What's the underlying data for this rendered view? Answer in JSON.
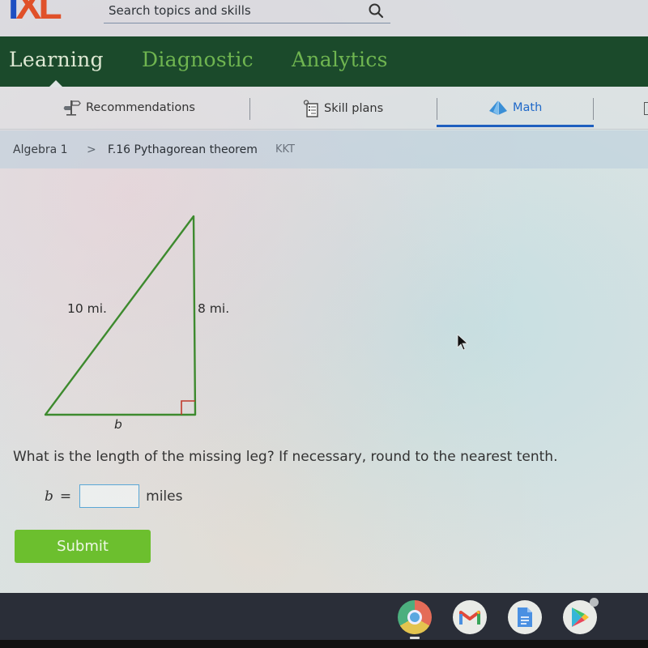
{
  "header": {
    "logo": {
      "i": "I",
      "x": "X",
      "l": "L"
    },
    "search_placeholder": "Search topics and skills",
    "search_icon": "search-icon"
  },
  "nav": {
    "items": [
      {
        "label": "Learning",
        "active": true
      },
      {
        "label": "Diagnostic",
        "active": false
      },
      {
        "label": "Analytics",
        "active": false
      }
    ]
  },
  "subnav": {
    "items": [
      {
        "label": "Recommendations",
        "icon": "signpost-icon",
        "active": false
      },
      {
        "label": "Skill plans",
        "icon": "clipboard-icon",
        "active": false
      },
      {
        "label": "Math",
        "icon": "pyramid-icon",
        "active": true
      }
    ],
    "accent_color": "#1f5fbf"
  },
  "breadcrumb": {
    "subject": "Algebra 1",
    "separator": ">",
    "skill": "F.16 Pythagorean theorem",
    "code": "KKT"
  },
  "problem": {
    "figure": {
      "hypotenuse_label": "10 mi.",
      "leg_label": "8 mi.",
      "missing_leg_label": "b",
      "line_color": "#3d8a2e",
      "right_angle_color": "#c0392b"
    },
    "question": "What is the length of the missing leg? If necessary, round to the nearest tenth.",
    "answer": {
      "variable": "b",
      "equals": "=",
      "value": "",
      "unit": "miles"
    },
    "submit_label": "Submit"
  },
  "taskbar": {
    "apps": [
      {
        "name": "Chrome",
        "icon": "chrome-icon",
        "active": true
      },
      {
        "name": "Gmail",
        "icon": "gmail-icon",
        "active": false
      },
      {
        "name": "Docs",
        "icon": "docs-icon",
        "active": false
      },
      {
        "name": "Play Store",
        "icon": "play-store-icon",
        "active": false
      }
    ]
  }
}
